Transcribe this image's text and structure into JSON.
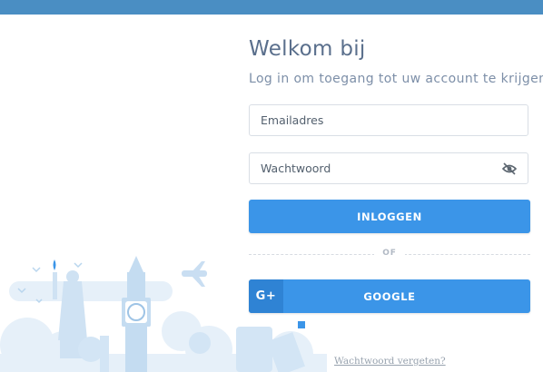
{
  "header": {
    "title": "Welkom bij",
    "subtitle": "Log in om toegang tot uw account te krijgen"
  },
  "form": {
    "email_placeholder": "Emailadres",
    "email_value": "",
    "password_placeholder": "Wachtwoord",
    "password_value": "",
    "password_toggle_icon": "eye-slash-icon",
    "login_label": "INLOGGEN",
    "or_label": "OF",
    "google_icon_text": "G+",
    "google_label": "GOOGLE",
    "forgot_label": "Wachtwoord vergeten?"
  },
  "colors": {
    "topbar": "#4a8ec3",
    "primary": "#3b95e8",
    "google_icon_bg": "#2f83d4",
    "title": "#5a6f8c",
    "illustration": "#d6e8f6"
  }
}
